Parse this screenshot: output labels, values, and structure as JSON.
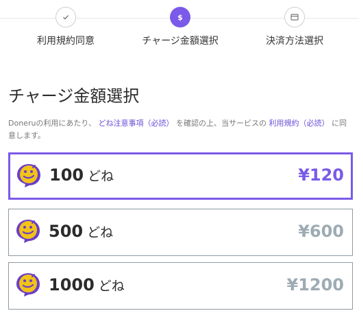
{
  "steps": [
    {
      "label": "利用規約同意",
      "state": "done",
      "icon": "check-icon"
    },
    {
      "label": "チャージ金額選択",
      "state": "active",
      "icon_text": "$"
    },
    {
      "label": "決済方法選択",
      "state": "todo",
      "icon": "credit-card-icon"
    }
  ],
  "page_title": "チャージ金額選択",
  "notice": {
    "prefix": "Doneruの利用にあたり、",
    "link1": "どね注意事項（必読）",
    "middle": "を確認の上、当サービスの",
    "link2": "利用規約（必読）",
    "suffix": "に同意します。"
  },
  "options": [
    {
      "amount": "100",
      "unit": "どね",
      "price": "¥120",
      "selected": true
    },
    {
      "amount": "500",
      "unit": "どね",
      "price": "¥600",
      "selected": false
    },
    {
      "amount": "1000",
      "unit": "どね",
      "price": "¥1200",
      "selected": false
    }
  ],
  "colors": {
    "accent": "#7a5ae8",
    "icon_yellow": "#f2c318",
    "icon_purple": "#6a3fc8",
    "price_muted": "#9eabb3"
  }
}
